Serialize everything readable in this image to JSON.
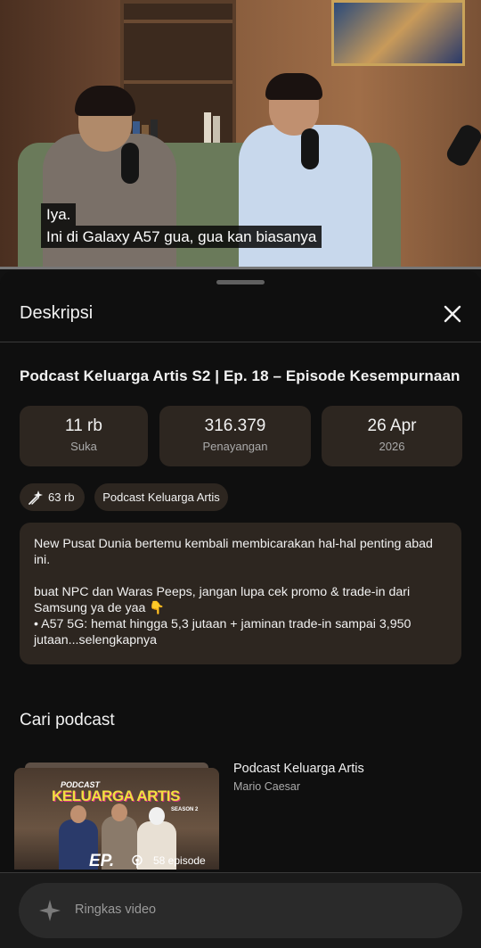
{
  "video": {
    "caption_line1": "Iya.",
    "caption_line2": "Ini di Galaxy A57 gua, gua kan biasanya"
  },
  "sheet": {
    "title": "Deskripsi",
    "close_icon": "close-icon"
  },
  "video_title": "Podcast Keluarga Artis S2 | Ep. 18 – Episode Kesempurnaan",
  "stats": [
    {
      "value": "11 rb",
      "label": "Suka"
    },
    {
      "value": "316.379",
      "label": "Penayangan"
    },
    {
      "value": "26 Apr",
      "label": "2026"
    }
  ],
  "chips": {
    "thanks_icon": "super-thanks-icon",
    "thanks_count": "63 rb",
    "channel": "Podcast Keluarga Artis"
  },
  "description": {
    "line1": "New Pusat Dunia bertemu kembali membicarakan hal-hal penting abad ini.",
    "line2": "buat NPC dan Waras Peeps, jangan lupa cek promo & trade-in dari Samsung ya de yaa 👇",
    "line3": "•  A57 5G: hemat hingga 5,3 jutaan + jaminan trade-in sampai 3,950 jutaan...selengkapnya"
  },
  "podcast_section": {
    "title": "Cari podcast",
    "thumbnail": {
      "logo_line1": "PODCAST",
      "logo_line2": "KELUARGA ARTIS",
      "logo_line3": "SEASON 2",
      "ep_text": "EP."
    },
    "episode_icon": "podcast-icon",
    "episodes": "58 episode",
    "podcast_name": "Podcast Keluarga Artis",
    "author": "Mario Caesar"
  },
  "bottom": {
    "summary_icon": "sparkle-icon",
    "summary_label": "Ringkas video"
  },
  "colors": {
    "background": "#0f0f0f",
    "card": "#2d2620",
    "text": "#f1f1f1",
    "secondary_text": "#aaaaaa"
  }
}
